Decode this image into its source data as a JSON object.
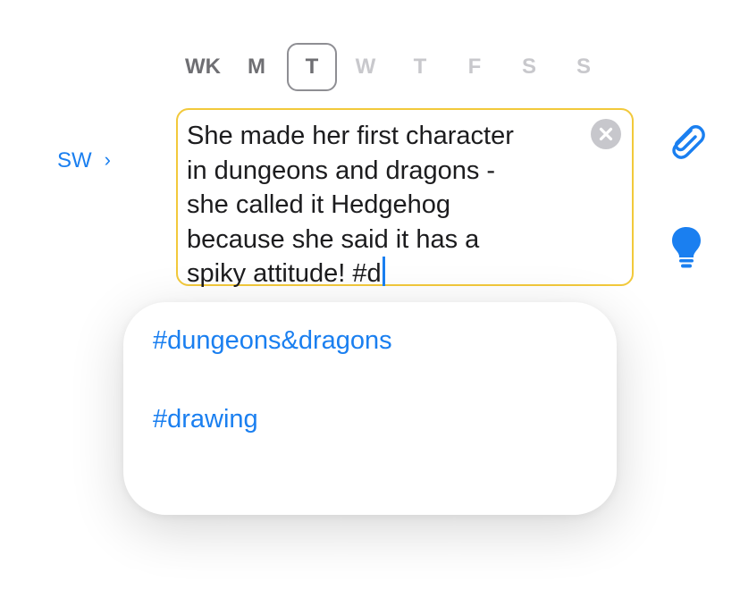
{
  "weekdays": {
    "wk": "WK",
    "mon": "M",
    "tue": "T",
    "wed": "W",
    "thu": "T",
    "fri": "F",
    "sat": "S",
    "sun": "S",
    "selected": "tue"
  },
  "sw_link": {
    "label": "SW",
    "chevron": "›"
  },
  "editor": {
    "text": "She made her first character\nin dungeons and dragons -\nshe called it Hedgehog\nbecause she said it has a\nspiky attitude! #d"
  },
  "icons": {
    "clear": "clear-icon",
    "attach": "paperclip-icon",
    "hint": "lightbulb-icon"
  },
  "suggestions": [
    {
      "tag": "#dungeons&dragons"
    },
    {
      "tag": "#drawing"
    }
  ],
  "colors": {
    "accent": "#1a7ff0",
    "editor_border": "#f2c93b",
    "muted": "#c8c8cc",
    "strong": "#6f6f73"
  }
}
